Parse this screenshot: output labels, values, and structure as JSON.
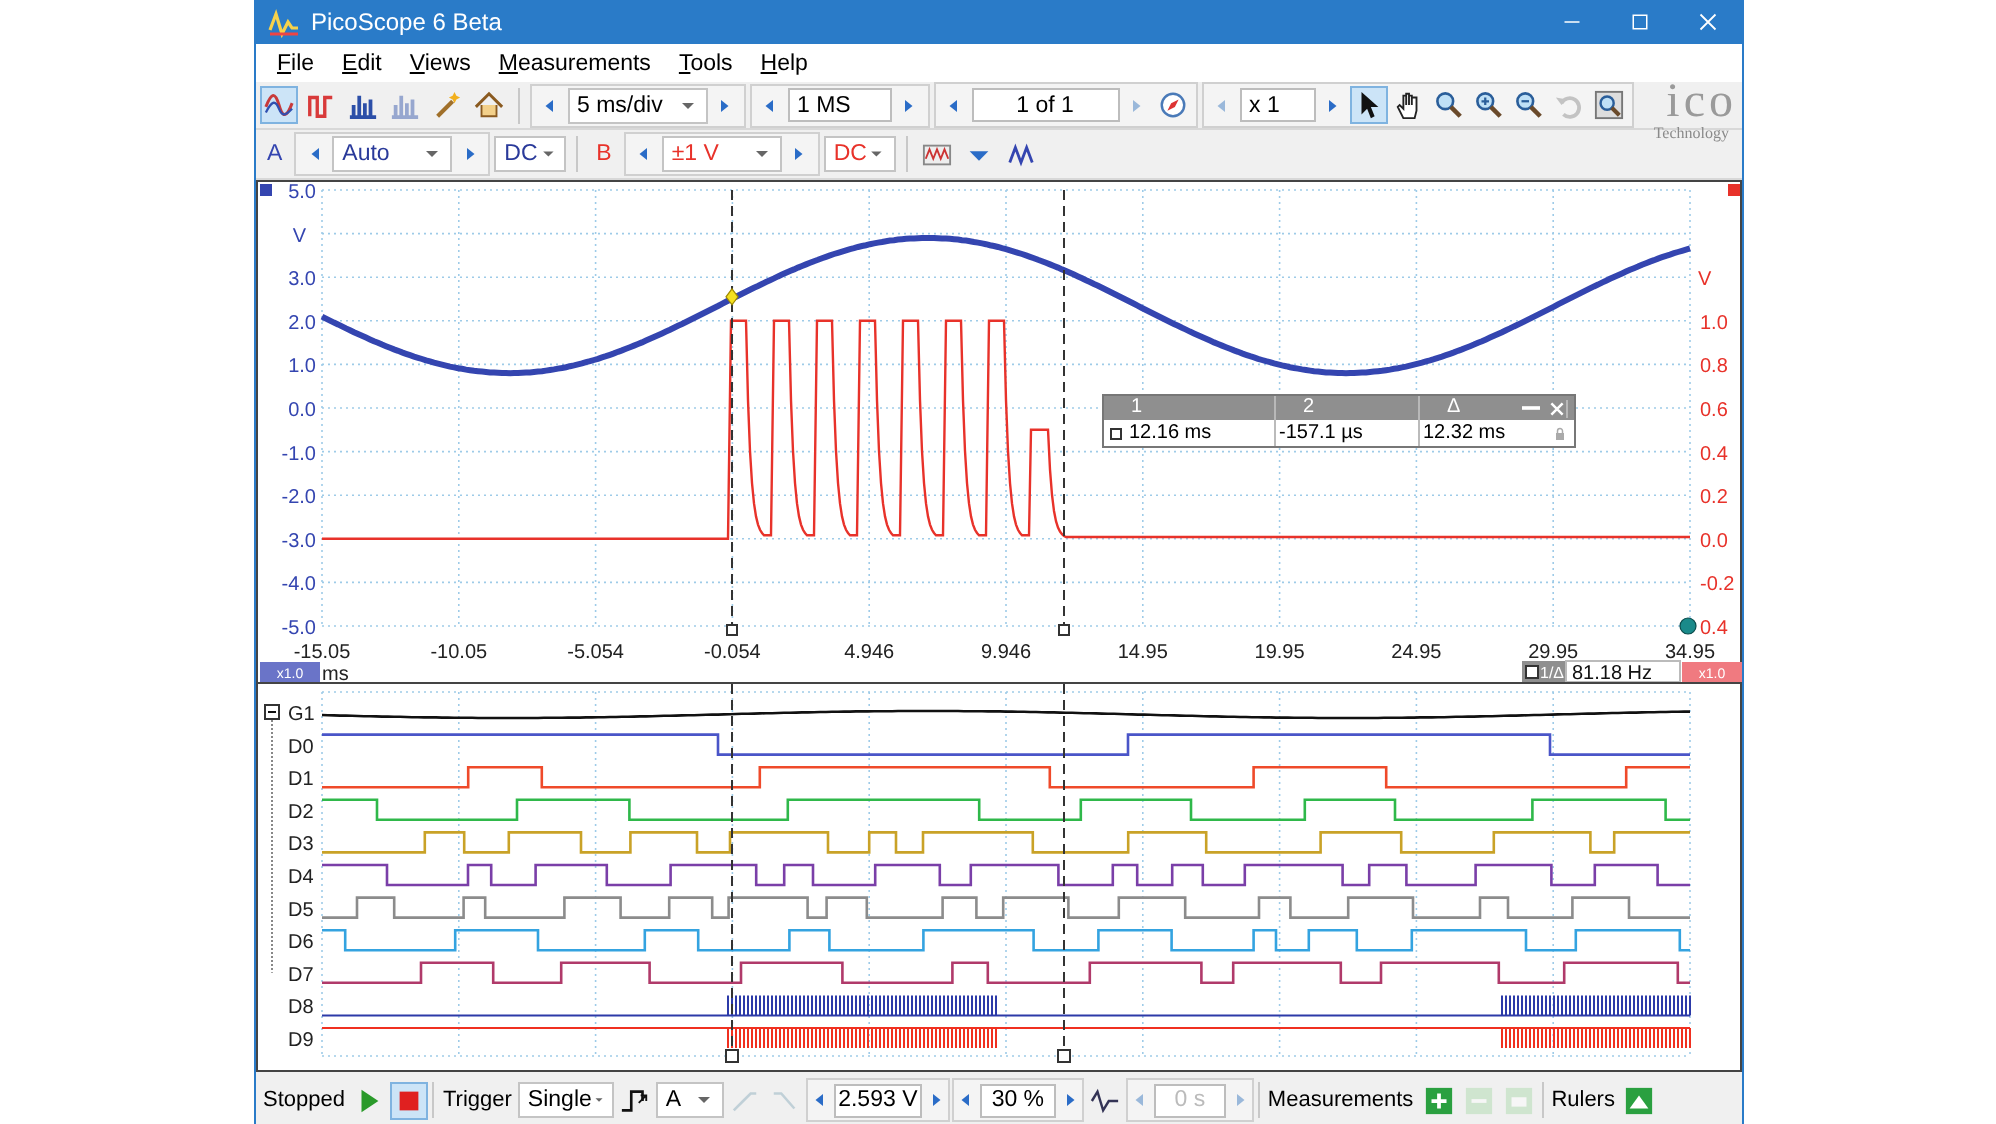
{
  "window": {
    "title": "PicoScope 6 Beta"
  },
  "menu": [
    {
      "label": "File"
    },
    {
      "label": "Edit"
    },
    {
      "label": "Views"
    },
    {
      "label": "Measurements"
    },
    {
      "label": "Tools"
    },
    {
      "label": "Help"
    }
  ],
  "modes": [
    {
      "kind": "scope",
      "selected": true,
      "disabled": false
    },
    {
      "kind": "persistence",
      "selected": false,
      "disabled": false
    },
    {
      "kind": "spectrum",
      "selected": false,
      "disabled": false
    },
    {
      "kind": "spectrum",
      "selected": false,
      "disabled": true
    }
  ],
  "timebase": "5 ms/div",
  "samples": "1 MS",
  "buffer": "1 of 1",
  "zoom": "x 1",
  "tools": [
    {
      "kind": "pointer",
      "selected": true,
      "disabled": false
    },
    {
      "kind": "hand",
      "selected": false,
      "disabled": false
    },
    {
      "kind": "zoom",
      "selected": false,
      "disabled": false
    },
    {
      "kind": "zoom-in",
      "selected": false,
      "disabled": false
    },
    {
      "kind": "zoom-out",
      "selected": false,
      "disabled": false
    },
    {
      "kind": "undo",
      "selected": false,
      "disabled": true
    },
    {
      "kind": "zoom-fit",
      "selected": false,
      "disabled": false
    }
  ],
  "logo": {
    "text": "ico",
    "subtitle": "Technology"
  },
  "channels": [
    {
      "name": "A",
      "range": "Auto",
      "coupling": "DC",
      "color": "#3445b0"
    },
    {
      "name": "B",
      "range": "±1 V",
      "coupling": "DC",
      "color": "#e8322a"
    }
  ],
  "scope": {
    "left_labels": [
      "5.0",
      "V",
      "3.0",
      "2.0",
      "1.0",
      "0.0",
      "-1.0",
      "-2.0",
      "-3.0",
      "-4.0",
      "-5.0"
    ],
    "right_labels": [
      "V",
      "1.0",
      "0.8",
      "0.6",
      "0.4",
      "0.2",
      "0.0",
      "-0.2",
      "0.4"
    ],
    "x_ticks": [
      "-15.05",
      "-10.05",
      "-5.054",
      "-0.054",
      "4.946",
      "9.946",
      "14.95",
      "19.95",
      "24.95",
      "29.95",
      "34.95"
    ],
    "x_unit": "ms",
    "left_scale": "x1.0",
    "right_scale": "x1.0",
    "frequency_mode": "1/Δ",
    "frequency": "81.18 Hz"
  },
  "rulers": {
    "headers": [
      "1",
      "2",
      "Δ"
    ],
    "values": [
      "12.16 ms",
      "-157.1 µs",
      "12.32 ms"
    ]
  },
  "digital": {
    "expanded": true,
    "channels": [
      {
        "name": "G1",
        "color": "#111111"
      },
      {
        "name": "D0",
        "color": "#4a55c8"
      },
      {
        "name": "D1",
        "color": "#ef4a2a"
      },
      {
        "name": "D2",
        "color": "#2fb84a"
      },
      {
        "name": "D3",
        "color": "#c9a227"
      },
      {
        "name": "D4",
        "color": "#7a3fa8"
      },
      {
        "name": "D5",
        "color": "#8c8c8c"
      },
      {
        "name": "D6",
        "color": "#34a3e0"
      },
      {
        "name": "D7",
        "color": "#b03a6a"
      },
      {
        "name": "D8",
        "color": "#2c3aa8"
      },
      {
        "name": "D9",
        "color": "#f03020"
      }
    ]
  },
  "status": {
    "state": "Stopped",
    "running": false,
    "trigger_label": "Trigger",
    "trigger_mode": "Single",
    "trigger_channel": "A",
    "threshold": "2.593 V",
    "pre_trigger": "30 %",
    "delay": "0 s",
    "delay_disabled": true,
    "measurements_label": "Measurements",
    "rulers_label": "Rulers"
  }
}
